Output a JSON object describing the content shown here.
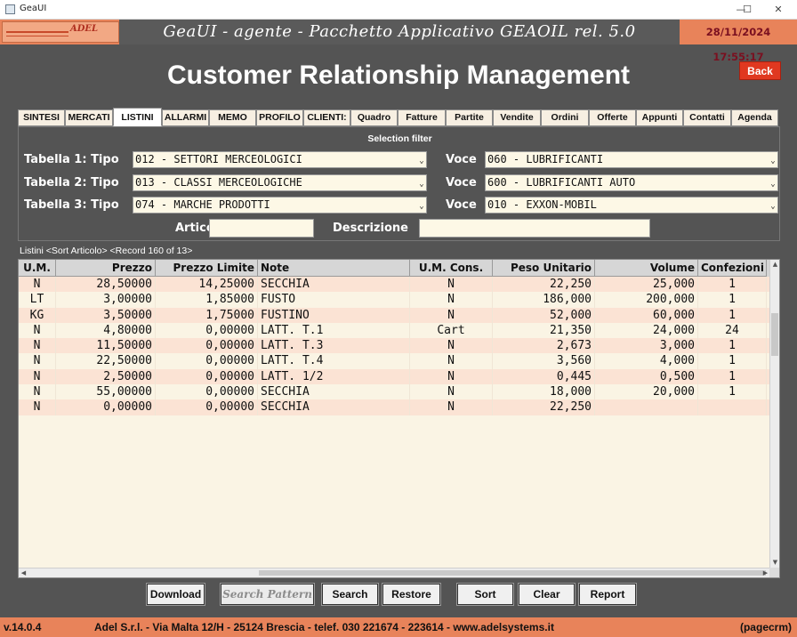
{
  "window": {
    "title": "GeaUI",
    "minimize": "—",
    "maximize": "☐",
    "close": "✕"
  },
  "header": {
    "logo_text": "ADEL",
    "app_title": "GeaUI - agente - Pacchetto Applicativo GEAOIL rel. 5.0",
    "datetime": "28/11/2024 17:55:17"
  },
  "page_title": "Customer Relationship Management",
  "back_label": "Back",
  "tabs": [
    {
      "label": "SINTESI"
    },
    {
      "label": "MERCATI"
    },
    {
      "label": "LISTINI",
      "active": true
    },
    {
      "label": "ALLARMI"
    },
    {
      "label": "MEMO"
    },
    {
      "label": "PROFILO"
    },
    {
      "label": "CLIENTI:"
    },
    {
      "label": "Quadro"
    },
    {
      "label": "Fatture"
    },
    {
      "label": "Partite"
    },
    {
      "label": "Vendite"
    },
    {
      "label": "Ordini"
    },
    {
      "label": "Offerte"
    },
    {
      "label": "Appunti"
    },
    {
      "label": "Contatti"
    },
    {
      "label": "Agenda"
    }
  ],
  "filter": {
    "title": "Selection filter",
    "rows": [
      {
        "label": "Tabella 1: Tipo",
        "tipo": "012 - SETTORI MERCEOLOGICI",
        "voce_label": "Voce",
        "voce": "060 - LUBRIFICANTI"
      },
      {
        "label": "Tabella 2: Tipo",
        "tipo": "013 - CLASSI MERCEOLOGICHE",
        "voce_label": "Voce",
        "voce": "600 - LUBRIFICANTI AUTO"
      },
      {
        "label": "Tabella 3: Tipo",
        "tipo": "074 - MARCHE PRODOTTI",
        "voce_label": "Voce",
        "voce": "010 - EXXON-MOBIL"
      }
    ],
    "articolo_label": "Articolo",
    "articolo_value": "",
    "descrizione_label": "Descrizione",
    "descrizione_value": ""
  },
  "list": {
    "header": "Listini <Sort Articolo> <Record 160 of 13>",
    "columns": [
      "U.M.",
      "Prezzo",
      "Prezzo Limite",
      "Note",
      "U.M. Cons.",
      "Peso Unitario",
      "Volume",
      "Confezioni"
    ],
    "rows": [
      [
        "N",
        "28,50000",
        "14,25000",
        "SECCHIA",
        "N",
        "22,250",
        "25,000",
        "1"
      ],
      [
        "LT",
        "3,00000",
        "1,85000",
        "FUSTO",
        "N",
        "186,000",
        "200,000",
        "1"
      ],
      [
        "KG",
        "3,50000",
        "1,75000",
        "FUSTINO",
        "N",
        "52,000",
        "60,000",
        "1"
      ],
      [
        "N",
        "4,80000",
        "0,00000",
        "LATT. T.1",
        "Cart",
        "21,350",
        "24,000",
        "24"
      ],
      [
        "N",
        "11,50000",
        "0,00000",
        "LATT. T.3",
        "N",
        "2,673",
        "3,000",
        "1"
      ],
      [
        "N",
        "22,50000",
        "0,00000",
        "LATT. T.4",
        "N",
        "3,560",
        "4,000",
        "1"
      ],
      [
        "N",
        "2,50000",
        "0,00000",
        "LATT. 1/2",
        "N",
        "0,445",
        "0,500",
        "1"
      ],
      [
        "N",
        "55,00000",
        "0,00000",
        "SECCHIA",
        "N",
        "18,000",
        "20,000",
        "1"
      ],
      [
        "N",
        "0,00000",
        "0,00000",
        "SECCHIA",
        "N",
        "22,250",
        "",
        ""
      ]
    ]
  },
  "buttons": {
    "download": "Download",
    "search_pattern": "Search Pattern",
    "search": "Search",
    "restore": "Restore",
    "sort": "Sort",
    "clear": "Clear",
    "report": "Report"
  },
  "footer": {
    "version": "v.14.0.4",
    "address": "Adel S.r.l. - Via Malta 12/H - 25124 Brescia - telef. 030 221674 - 223614 - www.adelsystems.it",
    "program": "(pagecrm)"
  },
  "icons": {
    "dropdown": "dropdown-arrow-icon",
    "window_icon": "app-window-icon"
  },
  "colors": {
    "header_orange": "#e8835a",
    "back_red": "#e03820",
    "row_alt": "#fbe3d4",
    "field_bg": "#fdf8e6",
    "panel_gray": "#545454"
  }
}
